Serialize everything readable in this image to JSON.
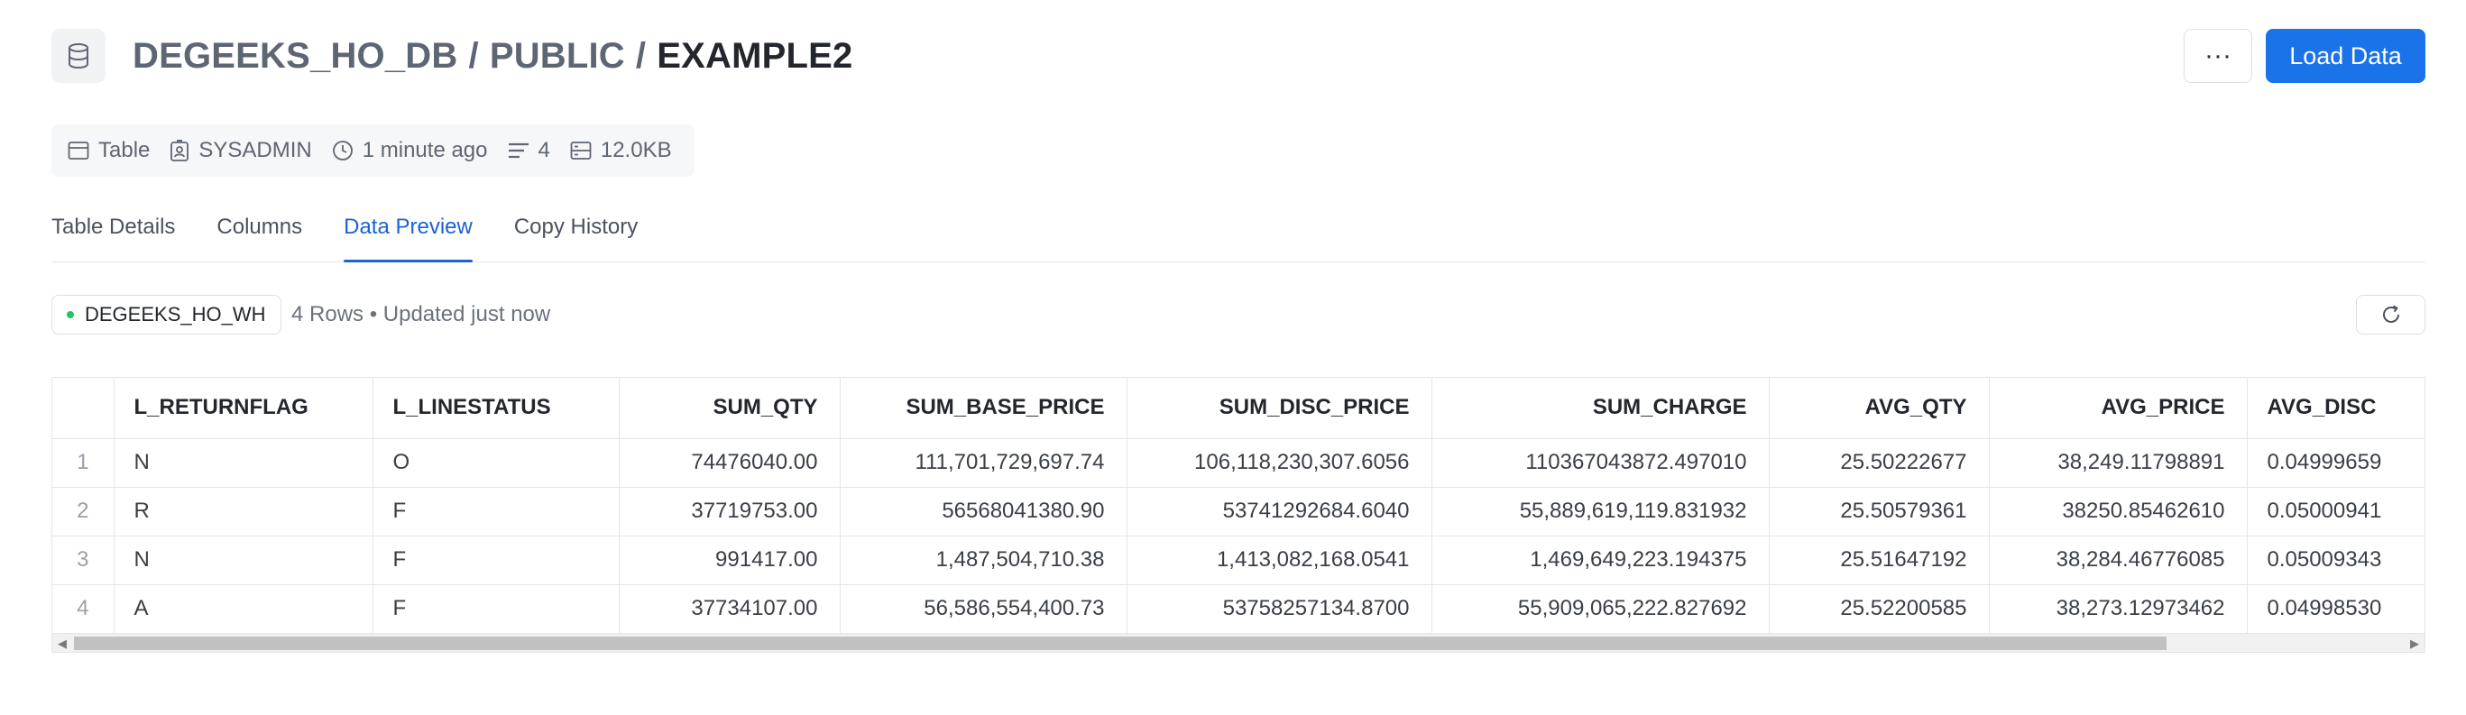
{
  "header": {
    "db": "DEGEEKS_HO_DB",
    "separator": "/",
    "schema": "PUBLIC",
    "table": "EXAMPLE2",
    "more_label": "···",
    "load_label": "Load Data"
  },
  "meta": {
    "type": "Table",
    "owner": "SYSADMIN",
    "updated": "1 minute ago",
    "columns_count": "4",
    "size": "12.0KB"
  },
  "tabs": [
    {
      "label": "Table Details",
      "active": false
    },
    {
      "label": "Columns",
      "active": false
    },
    {
      "label": "Data Preview",
      "active": true
    },
    {
      "label": "Copy History",
      "active": false
    }
  ],
  "status": {
    "warehouse": "DEGEEKS_HO_WH",
    "summary": "4 Rows • Updated just now"
  },
  "table": {
    "columns": [
      "L_RETURNFLAG",
      "L_LINESTATUS",
      "SUM_QTY",
      "SUM_BASE_PRICE",
      "SUM_DISC_PRICE",
      "SUM_CHARGE",
      "AVG_QTY",
      "AVG_PRICE",
      "AVG_DISC"
    ],
    "rows": [
      {
        "idx": "1",
        "cells": [
          "N",
          "O",
          "74476040.00",
          "111,701,729,697.74",
          "106,118,230,307.6056",
          "110367043872.497010",
          "25.50222677",
          "38,249.11798891",
          "0.04999659"
        ]
      },
      {
        "idx": "2",
        "cells": [
          "R",
          "F",
          "37719753.00",
          "56568041380.90",
          "53741292684.6040",
          "55,889,619,119.831932",
          "25.50579361",
          "38250.85462610",
          "0.05000941"
        ]
      },
      {
        "idx": "3",
        "cells": [
          "N",
          "F",
          "991417.00",
          "1,487,504,710.38",
          "1,413,082,168.0541",
          "1,469,649,223.194375",
          "25.51647192",
          "38,284.46776085",
          "0.05009343"
        ]
      },
      {
        "idx": "4",
        "cells": [
          "A",
          "F",
          "37734107.00",
          "56,586,554,400.73",
          "53758257134.8700",
          "55,909,065,222.827692",
          "25.52200585",
          "38,273.12973462",
          "0.04998530"
        ]
      }
    ]
  },
  "colors": {
    "accent": "#1a73e8",
    "tab_active": "#1a62d6",
    "status_dot": "#22c55e"
  }
}
